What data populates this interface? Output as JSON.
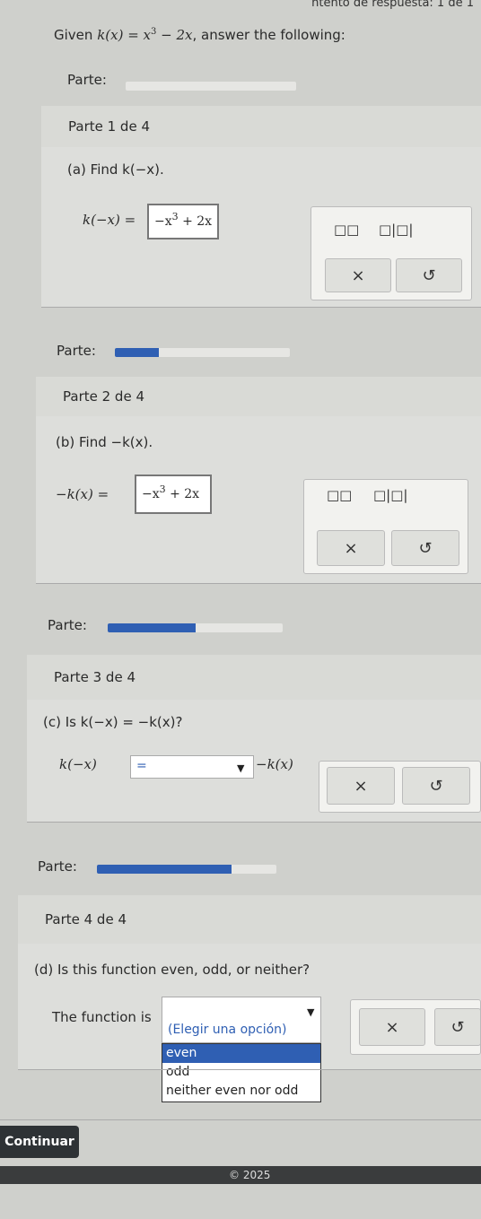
{
  "status": {
    "attempt_text": "ntento de respuesta: 1 de 1"
  },
  "given": {
    "prefix": "Given",
    "function": "k(x) = x³ − 2x",
    "suffix": ", answer the following:"
  },
  "parts": [
    {
      "parte_label": "Parte:",
      "progress": 0.0,
      "header": "Parte 1 de 4",
      "prompt": "(a) Find k(−x).",
      "eq_left": "k(−x) =",
      "answer": "−x",
      "answer_exp": "3",
      "answer_rest": "+ 2x"
    },
    {
      "parte_label": "Parte:",
      "progress": 0.25,
      "header": "Parte 2 de 4",
      "prompt": "(b) Find −k(x).",
      "eq_left": "−k(x) =",
      "answer": "−x",
      "answer_exp": "3",
      "answer_rest": "+ 2x"
    },
    {
      "parte_label": "Parte:",
      "progress": 0.5,
      "header": "Parte 3 de 4",
      "prompt": "(c) Is k(−x) = −k(x)?",
      "eq_left": "k(−x)",
      "select_value": "=",
      "eq_right": "−k(x)"
    },
    {
      "parte_label": "Parte:",
      "progress": 0.75,
      "header": "Parte 4 de 4",
      "prompt": "(d) Is this function even, odd, or neither?",
      "lead": "The function is",
      "select_value": "(Elegir una opción)",
      "options": [
        "even",
        "odd",
        "neither even nor odd"
      ],
      "highlighted_option": "even"
    }
  ],
  "tools": {
    "exponent_icon": "□□",
    "abs_icon": "□|□|",
    "clear_icon": "×",
    "undo_icon": "↺"
  },
  "continue_label": "Continuar",
  "footer_text": "© 2025"
}
